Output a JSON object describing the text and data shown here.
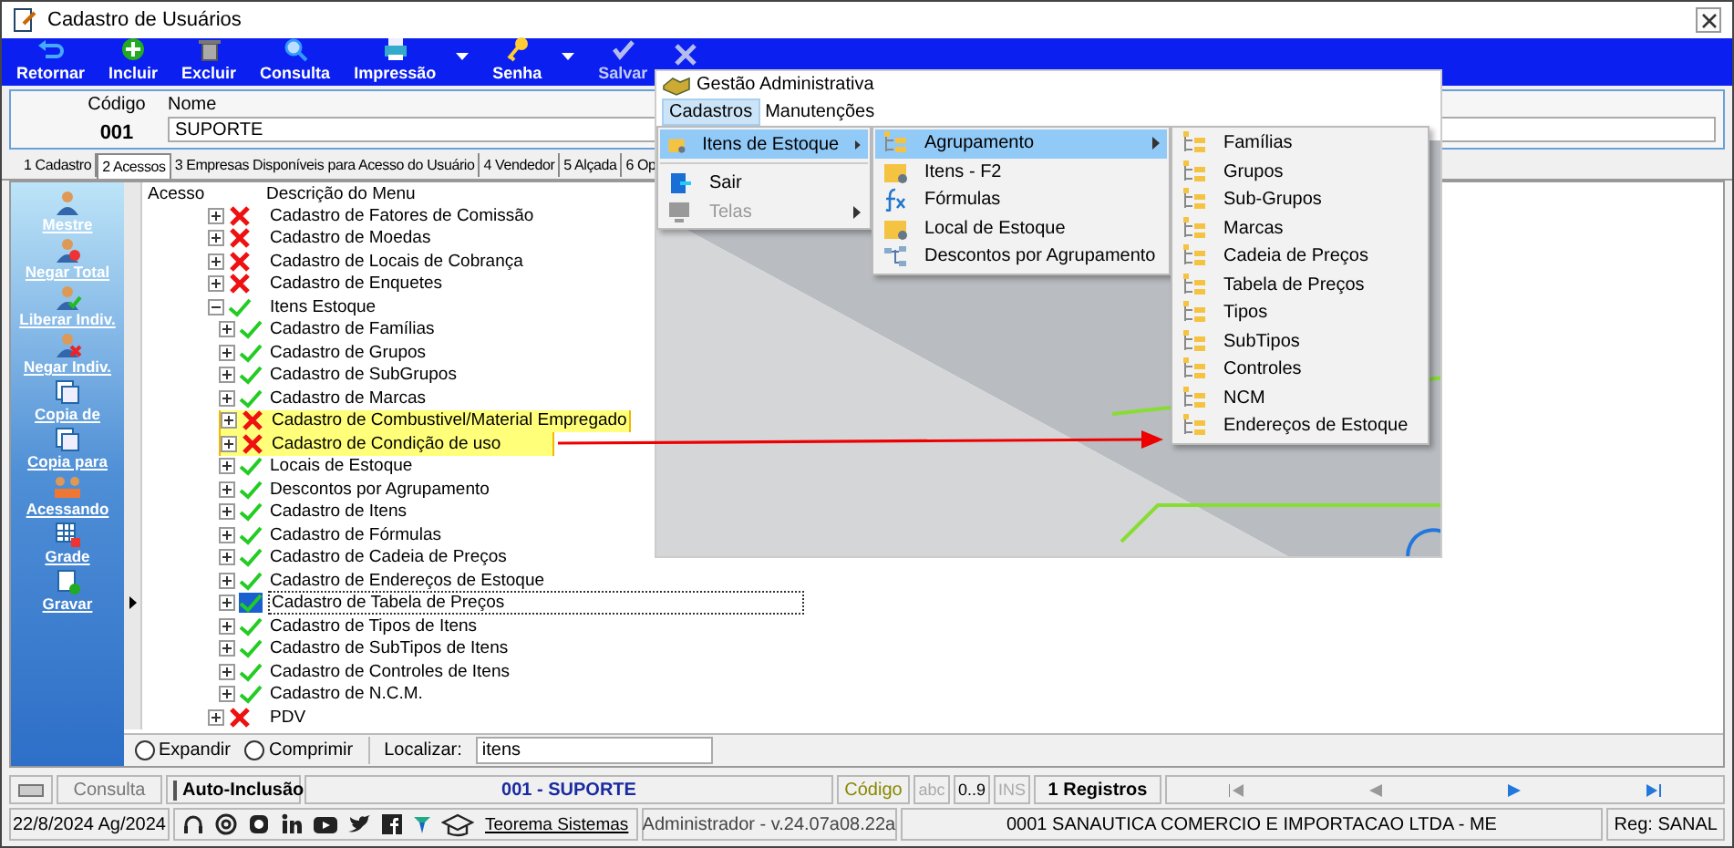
{
  "window": {
    "title": "Cadastro de Usuários"
  },
  "toolbar": [
    {
      "label": "Retornar",
      "disabled": false,
      "dropdown": false
    },
    {
      "label": "Incluir",
      "disabled": false,
      "dropdown": false
    },
    {
      "label": "Excluir",
      "disabled": false,
      "dropdown": false
    },
    {
      "label": "Consulta",
      "disabled": false,
      "dropdown": false
    },
    {
      "label": "Impressão",
      "disabled": false,
      "dropdown": true
    },
    {
      "label": "Senha",
      "disabled": false,
      "dropdown": true
    },
    {
      "label": "Salvar",
      "disabled": true,
      "dropdown": false
    },
    {
      "disabled": true,
      "dropdown": false
    }
  ],
  "header": {
    "code_label": "Código",
    "code": "001",
    "name_label": "Nome",
    "name": "SUPORTE"
  },
  "tabs": [
    {
      "label": "1 Cadastro",
      "selected": false
    },
    {
      "label": "2 Acessos",
      "selected": true
    },
    {
      "label": "3 Empresas Disponíveis para Acesso do Usuário",
      "selected": false
    },
    {
      "label": "4 Vendedor",
      "selected": false
    },
    {
      "label": "5 Alçada",
      "selected": false
    },
    {
      "label": "6 Op",
      "selected": false
    }
  ],
  "sidebar": [
    "Mestre",
    "Negar Total",
    "Liberar Indiv.",
    "Negar Indiv.",
    "Copia de",
    "Copia para",
    "Acessando",
    "Grade",
    "Gravar"
  ],
  "tree": {
    "columns": [
      "Acesso",
      "Descrição do Menu"
    ],
    "rows": [
      {
        "label": "Cadastro de Fatores de Comissão",
        "allowed": false,
        "expanded": false,
        "highlighted": false,
        "selected": false
      },
      {
        "label": "Cadastro de Moedas",
        "allowed": false,
        "expanded": false,
        "highlighted": false,
        "selected": false
      },
      {
        "label": "Cadastro de Locais de Cobrança",
        "allowed": false,
        "expanded": false,
        "highlighted": false,
        "selected": false
      },
      {
        "label": "Cadastro de Enquetes",
        "allowed": false,
        "expanded": false,
        "highlighted": false,
        "selected": false
      },
      {
        "label": "Itens Estoque",
        "allowed": true,
        "expanded": true,
        "highlighted": false,
        "selected": false,
        "children": [
          {
            "label": "Cadastro de Famílias",
            "allowed": true,
            "expanded": false,
            "highlighted": false,
            "selected": false
          },
          {
            "label": "Cadastro de Grupos",
            "allowed": true,
            "expanded": false,
            "highlighted": false,
            "selected": false
          },
          {
            "label": "Cadastro de SubGrupos",
            "allowed": true,
            "expanded": false,
            "highlighted": false,
            "selected": false
          },
          {
            "label": "Cadastro de Marcas",
            "allowed": true,
            "expanded": false,
            "highlighted": false,
            "selected": false
          },
          {
            "label": "Cadastro de Combustivel/Material Empregado",
            "allowed": false,
            "expanded": false,
            "highlighted": true,
            "selected": false
          },
          {
            "label": "Cadastro de Condição de uso",
            "allowed": false,
            "expanded": false,
            "highlighted": true,
            "selected": false
          },
          {
            "label": "Locais de Estoque",
            "allowed": true,
            "expanded": false,
            "highlighted": false,
            "selected": false
          },
          {
            "label": "Descontos por Agrupamento",
            "allowed": true,
            "expanded": false,
            "highlighted": false,
            "selected": false
          },
          {
            "label": "Cadastro de Itens",
            "allowed": true,
            "expanded": false,
            "highlighted": false,
            "selected": false
          },
          {
            "label": "Cadastro de Fórmulas",
            "allowed": true,
            "expanded": false,
            "highlighted": false,
            "selected": false
          },
          {
            "label": "Cadastro de Cadeia de Preços",
            "allowed": true,
            "expanded": false,
            "highlighted": false,
            "selected": false
          },
          {
            "label": "Cadastro de Endereços de Estoque",
            "allowed": true,
            "expanded": false,
            "highlighted": false,
            "selected": false
          },
          {
            "label": "Cadastro de Tabela de Preços",
            "allowed": true,
            "expanded": false,
            "highlighted": false,
            "selected": true
          },
          {
            "label": "Cadastro de Tipos de Itens",
            "allowed": true,
            "expanded": false,
            "highlighted": false,
            "selected": false
          },
          {
            "label": "Cadastro de SubTipos de Itens",
            "allowed": true,
            "expanded": false,
            "highlighted": false,
            "selected": false
          },
          {
            "label": "Cadastro de Controles de Itens",
            "allowed": true,
            "expanded": false,
            "highlighted": false,
            "selected": false
          },
          {
            "label": "Cadastro de N.C.M.",
            "allowed": true,
            "expanded": false,
            "highlighted": false,
            "selected": false
          }
        ]
      },
      {
        "label": "PDV",
        "allowed": false,
        "expanded": false,
        "highlighted": false,
        "selected": false
      }
    ]
  },
  "tree_footer": {
    "options": [
      {
        "label": "Expandir",
        "selected": false
      },
      {
        "label": "Comprimir",
        "selected": false
      }
    ],
    "search_label": "Localizar:",
    "search_value": "itens"
  },
  "status_bar": {
    "mode": "Consulta",
    "auto_include": {
      "label": "Auto-Inclusão",
      "checked": false
    },
    "user": "001 - SUPORTE",
    "field": "Código",
    "indicators": [
      {
        "label": "abc",
        "on": false
      },
      {
        "label": "0..9",
        "on": true
      },
      {
        "label": "INS",
        "on": false
      }
    ],
    "records": "1 Registros"
  },
  "footer": {
    "date": "22/8/2024 Ag/2024",
    "link": "Teorema Sistemas",
    "version": "Administrador - v.24.07a08.22a",
    "company": "0001 SANAUTICA COMERCIO E IMPORTACAO LTDA - ME",
    "registration": "Reg: SANAL"
  },
  "inset": {
    "title": "Gestão Administrativa",
    "menubar": [
      {
        "label": "Cadastros",
        "selected": true
      },
      {
        "label": "Manutenções",
        "selected": false
      }
    ],
    "menu": [
      {
        "label": "Itens de Estoque",
        "highlighted": true,
        "submenu": true,
        "disabled": false,
        "separator_before": false
      },
      {
        "label": "Sair",
        "highlighted": false,
        "submenu": false,
        "disabled": false,
        "separator_before": true
      },
      {
        "label": "Telas",
        "highlighted": false,
        "submenu": true,
        "disabled": true,
        "separator_before": false
      }
    ],
    "submenu": [
      {
        "label": "Agrupamento",
        "highlighted": true,
        "submenu": true
      },
      {
        "label": "Itens - F2",
        "highlighted": false,
        "submenu": false
      },
      {
        "label": "Fórmulas",
        "highlighted": false,
        "submenu": false
      },
      {
        "label": "Local de Estoque",
        "highlighted": false,
        "submenu": false
      },
      {
        "label": "Descontos por Agrupamento",
        "highlighted": false,
        "submenu": false
      }
    ],
    "submenu_2": [
      "Famílias",
      "Grupos",
      "Sub-Grupos",
      "Marcas",
      "Cadeia de Preços",
      "Tabela de Preços",
      "Tipos",
      "SubTipos",
      "Controles",
      "NCM",
      "Endereços de Estoque"
    ]
  }
}
